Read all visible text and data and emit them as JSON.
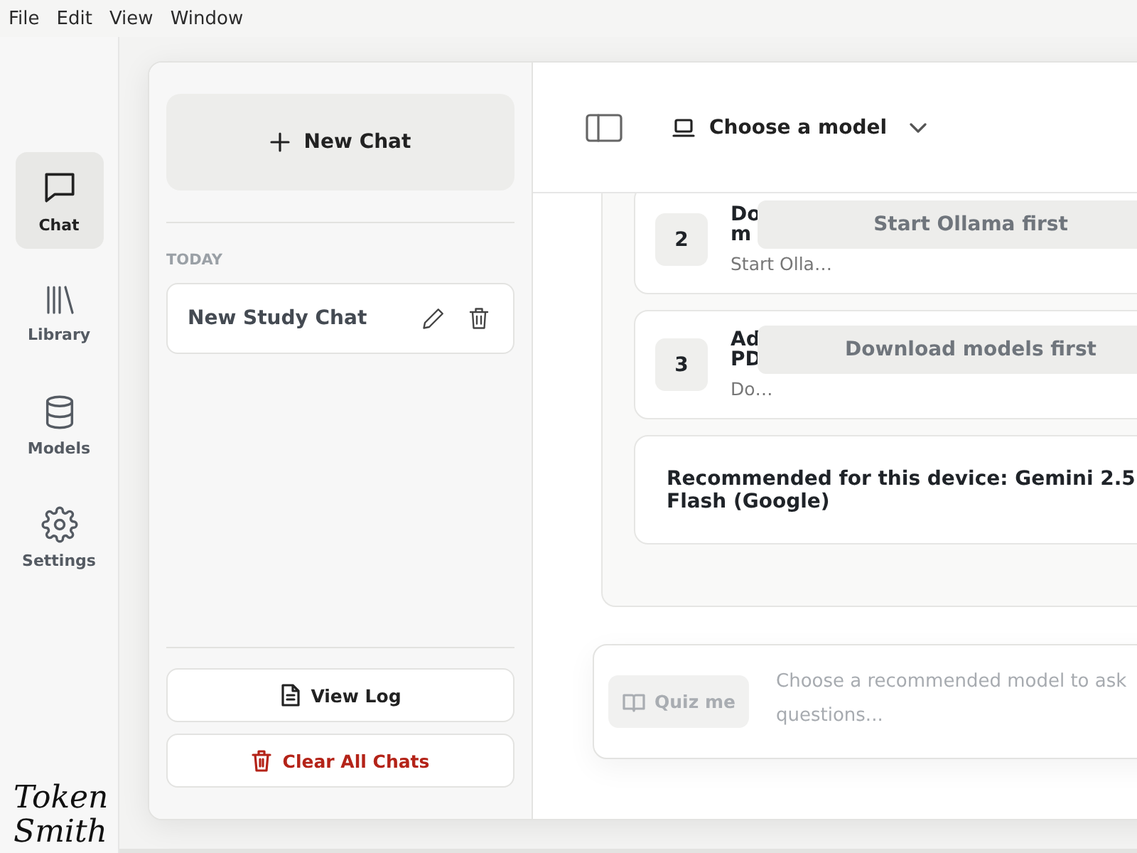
{
  "menu": [
    "File",
    "Edit",
    "View",
    "Window"
  ],
  "nav": [
    {
      "label": "Chat",
      "selected": true
    },
    {
      "label": "Library",
      "selected": false
    },
    {
      "label": "Models",
      "selected": false
    },
    {
      "label": "Settings",
      "selected": false
    }
  ],
  "logo": "Token Smith",
  "sidebar": {
    "new_chat": "New Chat",
    "section": "TODAY",
    "chats": [
      {
        "title": "New Study Chat"
      }
    ],
    "view_log": "View Log",
    "clear_all": "Clear All Chats"
  },
  "header": {
    "model_picker": "Choose a model"
  },
  "steps": [
    {
      "number": "2",
      "title_lines": [
        "Do",
        "m"
      ],
      "subtitle": "Start Olla…",
      "action": "Start Ollama first"
    },
    {
      "number": "3",
      "title_lines": [
        "Ad",
        "PD"
      ],
      "subtitle": "Do…",
      "action": "Download models first"
    }
  ],
  "recommendation": "Recommended for this device: Gemini 2.5 Flash (Google)",
  "composer": {
    "quiz": {
      "label": "Quiz me",
      "disabled": true
    },
    "placeholder": "Choose a recommended model to ask questions..."
  }
}
